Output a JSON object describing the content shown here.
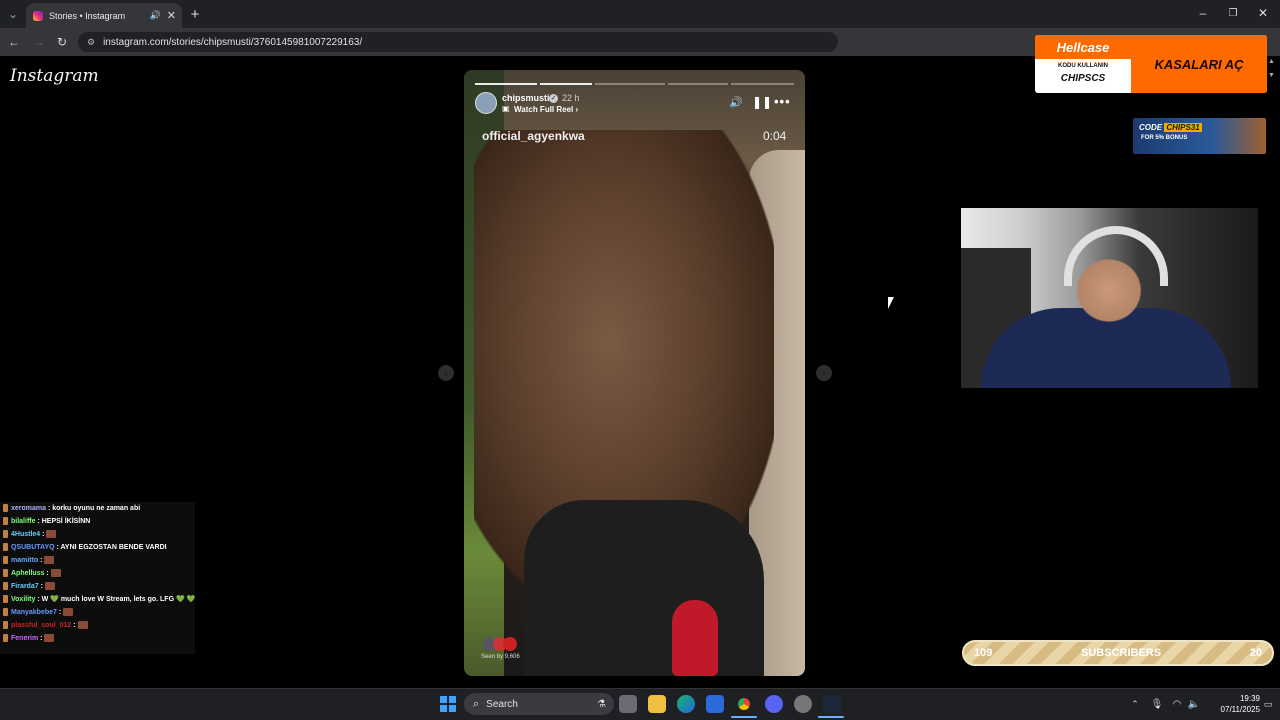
{
  "browser": {
    "tab_title": "Stories • Instagram",
    "url": "instagram.com/stories/chipsmusti/3760145981007229163/"
  },
  "instagram": {
    "logo": "Instagram"
  },
  "story": {
    "username": "chipsmusti",
    "time": "22 h",
    "watch_reel": "Watch Full Reel",
    "overlay_name": "official_agyenkwa",
    "overlay_time": "0:04",
    "seen_by": "Seen by 9,606"
  },
  "ads": {
    "hellcase_brand": "Hellcase",
    "hellcase_line1": "KODU KULLANIN",
    "hellcase_code": "CHIPSCS",
    "hellcase_cta": "KASALARI AÇ",
    "code_banner_prefix": "CODE",
    "code_banner_code": "CHIPS31",
    "code_banner_bonus": "FOR 5% BONUS"
  },
  "chat": [
    {
      "user": "xeromama",
      "msg": ": korku oyunu ne zaman abi",
      "color": "#b0b0ff"
    },
    {
      "user": "bilaliffe",
      "msg": ": HEPSİ İKİSİNN",
      "color": "#7fff7f"
    },
    {
      "user": "4Hustle4",
      "msg": ":",
      "color": "#66ccff"
    },
    {
      "user": "QSUBUTAYQ",
      "msg": ": AYNI EGZOSTAN BENDE VARDI",
      "color": "#6699ff"
    },
    {
      "user": "mamitto",
      "msg": ":",
      "color": "#66aaff"
    },
    {
      "user": "Aphelluss",
      "msg": ":",
      "color": "#7fff7f"
    },
    {
      "user": "Firarda7",
      "msg": ":",
      "color": "#66ccff"
    },
    {
      "user": "Voxility",
      "msg": ": W 💚 much love W Stream, lets go. LFG 💚 💚",
      "color": "#7fff7f"
    },
    {
      "user": "Manyakbebe7",
      "msg": ":",
      "color": "#6699ff"
    },
    {
      "user": "plassful_soul_012",
      "msg": ":",
      "color": "#cc2222"
    },
    {
      "user": "Fenerim",
      "msg": ":",
      "color": "#cc66ff"
    }
  ],
  "subscribers": {
    "left": "109",
    "label": "SUBSCRIBERS",
    "right": "20"
  },
  "taskbar": {
    "search": "Search",
    "time": "19:39",
    "date": "07/11/2025"
  }
}
